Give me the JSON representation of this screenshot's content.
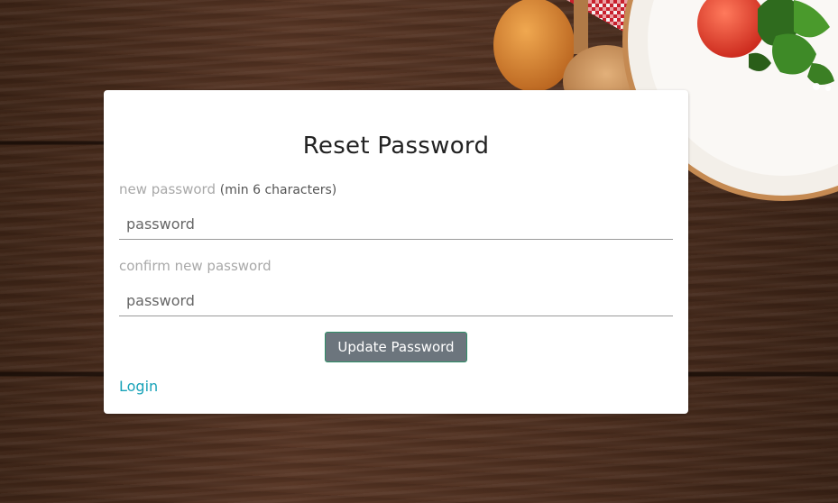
{
  "page": {
    "title": "Reset Password"
  },
  "form": {
    "new_password": {
      "label": "new password",
      "hint": "(min 6 characters)",
      "placeholder": "password",
      "value": ""
    },
    "confirm_password": {
      "label": "confirm new password",
      "placeholder": "password",
      "value": ""
    },
    "submit_label": "Update Password"
  },
  "links": {
    "login": "Login"
  },
  "colors": {
    "button_bg": "#6c757d",
    "button_border": "#2f8f68",
    "link": "#17a2b8",
    "label": "#a8a8a8",
    "card_bg": "#ffffff"
  },
  "background": {
    "description_icons": [
      "wood-plank-background",
      "wooden-spoon-icon",
      "checkered-napkin-icon",
      "salad-plate-icon"
    ]
  }
}
